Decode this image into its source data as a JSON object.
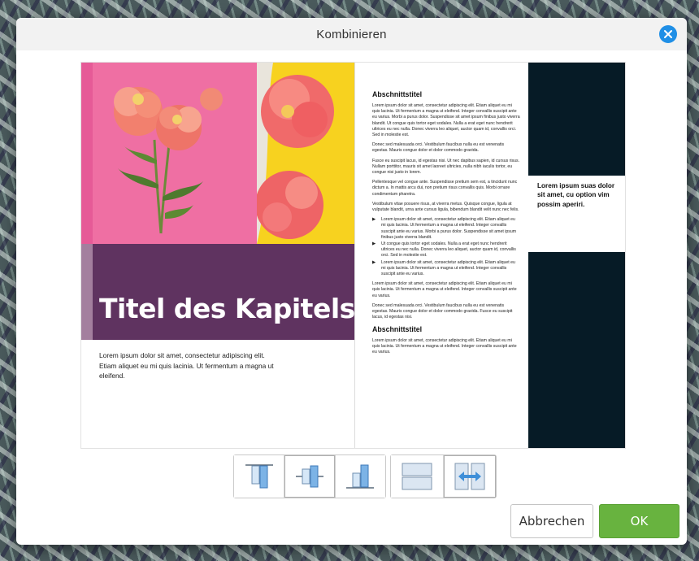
{
  "dialog": {
    "title": "Kombinieren"
  },
  "left_page": {
    "chapter_title": "Titel des Kapitels",
    "intro_text": "Lorem ipsum dolor sit amet, consectetur adipiscing elit. Etiam aliquet eu mi quis lacinia. Ut fermentum a magna ut eleifend."
  },
  "right_page": {
    "heading1": "Abschnittstitel",
    "p1": "Lorem ipsum dolor sit amet, consectetur adipiscing elit. Etiam aliquet eu mi quis lacinia. Ut fermentum a magna ut eleifend. Integer convallis suscipit ante eu varius. Morbi a purus dolor. Suspendisse sit amet ipsum finibus justo viverra blandit. Ut congue quis tortor eget sodales. Nulla a erat eget nunc hendrerit ultrices eu nec nulla. Donec viverra leo aliquet, auctor quam id, convallis orci. Sed in molestie est.",
    "p2": "Donec sed malesuada orci. Vestibulum faucibus nulla eu est venenatis egestas. Mauris congue dolor et dolor commodo gravida.",
    "p3": "Fusce eu suscipit lacus, id egestas nisi. Ut nec dapibus sapien, id cursus risus. Nullam porttitor, mauris sit amet laoreet ultricies, nulla nibh iaculis tortor, eu congue nisi justo in lorem.",
    "p4": "Pellentesque vel congue ante. Suspendisse pretium sem est, a tincidunt nunc dictum a. In mattis arcu dui, non pretium risus convallis quis. Morbi ornare condimentum pharetra.",
    "p5": "Vestibulum vitae posuere risus, at viverra metus. Quisque congue, ligula at vulputate blandit, urna ante cursus ligula, bibendum blandit velit nunc nec felis.",
    "bullets": [
      "Lorem ipsum dolor sit amet, consectetur adipiscing elit. Etiam aliquet eu mi quis lacinia. Ut fermentum a magna ut eleifend. Integer convallis suscipit ante eu varius. Morbi a purus dolor. Suspendisse sit amet ipsum finibus justo viverra blandit.",
      "Ut congue quis tortor eget sodales. Nulla a erat eget nunc hendrerit ultrices eu nec nulla. Donec viverra leo aliquet, auctor quam id, convallis orci. Sed in molestie est.",
      "Lorem ipsum dolor sit amet, consectetur adipiscing elit. Etiam aliquet eu mi quis lacinia. Ut fermentum a magna ut eleifend. Integer convallis suscipit ante eu varius."
    ],
    "p6": "Lorem ipsum dolor sit amet, consectetur adipiscing elit. Etiam aliquet eu mi quis lacinia. Ut fermentum a magna ut eleifend. Integer convallis suscipit ante eu varius.",
    "p7": "Donec sed malesuada orci. Vestibulum faucibus nulla eu est venenatis egestas. Mauris congue dolor et dolor commodo gravida. Fusce eu suscipit lacus, id egestas nisi.",
    "heading2": "Abschnittstitel",
    "p8": "Lorem ipsum dolor sit amet, consectetur adipiscing elit. Etiam aliquet eu mi quis lacinia. Ut fermentum a magna ut eleifend. Integer convallis suscipit ante eu varius.",
    "pullquote": "Lorem ipsum suas dolor sit amet, cu option vim possim aperiri."
  },
  "buttons": {
    "cancel": "Abbrechen",
    "ok": "OK"
  },
  "colors": {
    "accent_blue": "#1f8fe6",
    "ok_green": "#68b33f",
    "band_purple": "#5f3360",
    "sidebar_dark": "#061b26",
    "photo_pink": "#ef6fa3",
    "photo_yellow": "#f7d21f"
  },
  "icons": {
    "close": "close-icon",
    "align_top": "align-top-icon",
    "align_center": "align-middle-icon",
    "align_bottom": "align-bottom-icon",
    "stack_vertical": "stack-vertical-icon",
    "fit_width": "fit-width-icon"
  }
}
